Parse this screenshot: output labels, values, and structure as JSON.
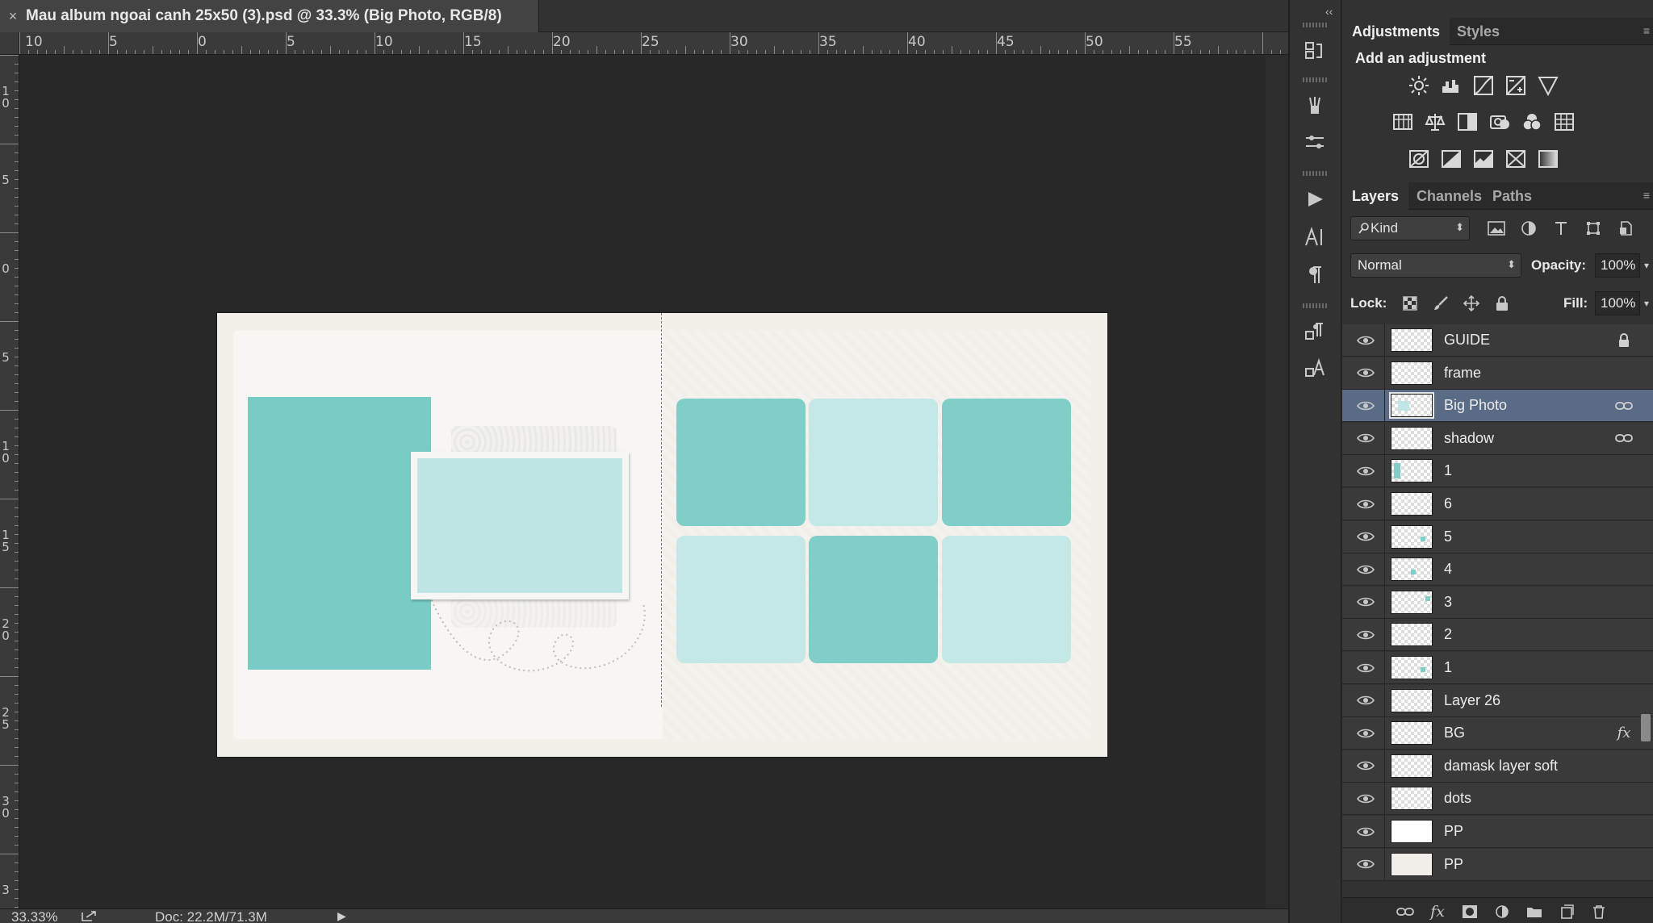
{
  "document": {
    "tab_title": "Mau album ngoai canh 25x50 (3).psd @ 33.3% (Big Photo, RGB/8)",
    "close_glyph": "×"
  },
  "ruler": {
    "top_labels": [
      "10",
      "5",
      "0",
      "5",
      "10",
      "15",
      "20",
      "25",
      "30",
      "35",
      "40",
      "45",
      "50",
      "55"
    ],
    "left_labels": [
      "1\n0",
      "5",
      "0",
      "5",
      "1\n0",
      "1\n5",
      "2\n0",
      "2\n5",
      "3\n0",
      "3"
    ]
  },
  "statusbar": {
    "zoom": "33.33%",
    "doc_size": "Doc: 22.2M/71.3M",
    "arrow": "▶"
  },
  "adjustments": {
    "tabs": [
      "Adjustments",
      "Styles"
    ],
    "title": "Add an adjustment",
    "icons": [
      "brightness-icon",
      "levels-icon",
      "curves-icon",
      "exposure-icon",
      "vibrance-icon",
      "hue-saturation-icon",
      "color-balance-icon",
      "black-white-icon",
      "photo-filter-icon",
      "channel-mixer-icon",
      "color-lookup-icon",
      "invert-icon",
      "posterize-icon",
      "threshold-icon",
      "selective-color-icon",
      "gradient-map-icon"
    ]
  },
  "layers_panel": {
    "tabs": [
      "Layers",
      "Channels",
      "Paths"
    ],
    "filter_label": "Kind",
    "blend_mode": "Normal",
    "opacity_label": "Opacity:",
    "opacity_value": "100%",
    "lock_label": "Lock:",
    "fill_label": "Fill:",
    "fill_value": "100%",
    "layers": [
      {
        "name": "GUIDE",
        "badge": "lock",
        "selected": false
      },
      {
        "name": "frame",
        "badge": "",
        "selected": false
      },
      {
        "name": "Big Photo",
        "badge": "link",
        "selected": true
      },
      {
        "name": "shadow",
        "badge": "link",
        "selected": false
      },
      {
        "name": "1",
        "badge": "",
        "selected": false
      },
      {
        "name": "6",
        "badge": "",
        "selected": false
      },
      {
        "name": "5",
        "badge": "",
        "selected": false
      },
      {
        "name": "4",
        "badge": "",
        "selected": false
      },
      {
        "name": "3",
        "badge": "",
        "selected": false
      },
      {
        "name": "2",
        "badge": "",
        "selected": false
      },
      {
        "name": "1",
        "badge": "",
        "selected": false
      },
      {
        "name": "Layer 26",
        "badge": "",
        "selected": false
      },
      {
        "name": "BG",
        "badge": "fx",
        "selected": false
      },
      {
        "name": "damask layer soft",
        "badge": "",
        "selected": false
      },
      {
        "name": "dots",
        "badge": "",
        "selected": false
      },
      {
        "name": "PP",
        "badge": "",
        "selected": false
      },
      {
        "name": "PP",
        "badge": "",
        "selected": false
      }
    ],
    "fx_glyph": "fx"
  },
  "colors": {
    "tile_dark": "#7fcec8",
    "tile_light": "#c3e8e6",
    "selected_row": "#5a6b85"
  }
}
